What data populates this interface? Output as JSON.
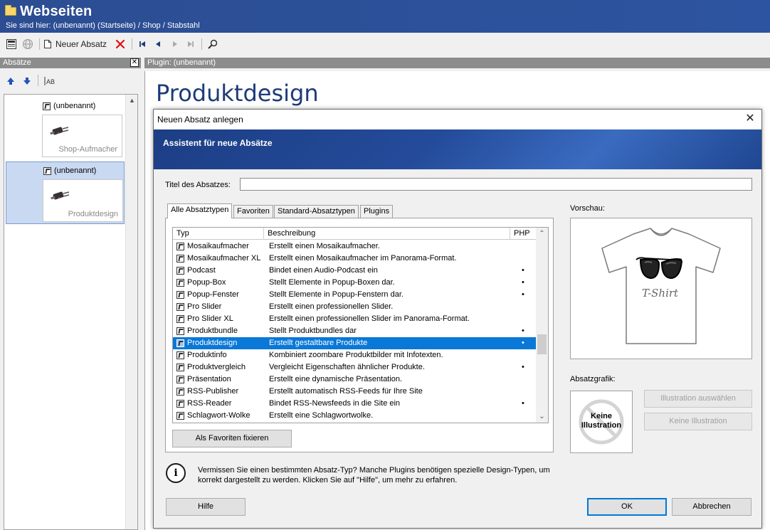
{
  "header": {
    "title": "Webseiten",
    "breadcrumb": "Sie sind hier: (unbenannt) (Startseite) / Shop / Stabstahl"
  },
  "toolbar": {
    "new_paragraph_label": "Neuer Absatz"
  },
  "left_panel": {
    "title": "Absätze",
    "items": [
      {
        "label": "(unbenannt)",
        "thumb_caption": "Shop-Aufmacher",
        "selected": false
      },
      {
        "label": "(unbenannt)",
        "thumb_caption": "Produktdesign",
        "selected": true
      }
    ]
  },
  "right_panel": {
    "title": "Plugin: (unbenannt)",
    "page_heading": "Produktdesign"
  },
  "dialog": {
    "title": "Neuen Absatz anlegen",
    "banner": "Assistent für neue Absätze",
    "title_field_label": "Titel des Absatzes:",
    "title_field_value": "",
    "tabs": [
      "Alle Absatztypen",
      "Favoriten",
      "Standard-Absatztypen",
      "Plugins"
    ],
    "active_tab": "Alle Absatztypen",
    "columns": [
      "Typ",
      "Beschreibung",
      "PHP"
    ],
    "rows": [
      {
        "typ": "Mosaikaufmacher",
        "desc": "Erstellt einen Mosaikaufmacher.",
        "php": ""
      },
      {
        "typ": "Mosaikaufmacher XL",
        "desc": "Erstellt einen Mosaikaufmacher im Panorama-Format.",
        "php": ""
      },
      {
        "typ": "Podcast",
        "desc": "Bindet einen Audio-Podcast ein",
        "php": "•"
      },
      {
        "typ": "Popup-Box",
        "desc": "Stellt Elemente in Popup-Boxen dar.",
        "php": "•"
      },
      {
        "typ": "Popup-Fenster",
        "desc": "Stellt Elemente in Popup-Fenstern dar.",
        "php": "•"
      },
      {
        "typ": "Pro Slider",
        "desc": "Erstellt einen professionellen Slider.",
        "php": ""
      },
      {
        "typ": "Pro Slider XL",
        "desc": "Erstellt einen professionellen Slider im Panorama-Format.",
        "php": ""
      },
      {
        "typ": "Produktbundle",
        "desc": "Stellt Produktbundles dar",
        "php": "•"
      },
      {
        "typ": "Produktdesign",
        "desc": "Erstellt gestaltbare Produkte",
        "php": "•",
        "selected": true
      },
      {
        "typ": "Produktinfo",
        "desc": "Kombiniert zoombare Produktbilder mit Infotexten.",
        "php": ""
      },
      {
        "typ": "Produktvergleich",
        "desc": "Vergleicht Eigenschaften ähnlicher Produkte.",
        "php": "•"
      },
      {
        "typ": "Präsentation",
        "desc": "Erstellt eine dynamische Präsentation.",
        "php": ""
      },
      {
        "typ": "RSS-Publisher",
        "desc": "Erstellt automatisch RSS-Feeds für Ihre Site",
        "php": ""
      },
      {
        "typ": "RSS-Reader",
        "desc": "Bindet RSS-Newsfeeds in die Site ein",
        "php": "•"
      },
      {
        "typ": "Schlagwort-Wolke",
        "desc": "Erstellt eine Schlagwortwolke.",
        "php": ""
      }
    ],
    "favorite_button": "Als Favoriten fixieren",
    "preview_label": "Vorschau:",
    "preview_text": "T-Shirt",
    "graphic_label": "Absatzgrafik:",
    "no_illustration_line1": "Keine",
    "no_illustration_line2": "Illustration",
    "select_illustration_button": "Illustration auswählen",
    "no_illustration_button": "Keine Illustration",
    "info_line1": "Vermissen Sie einen bestimmten Absatz-Typ? Manche Plugins benötigen spezielle Design-Typen, um",
    "info_line2": "korrekt dargestellt zu werden. Klicken Sie auf \"Hilfe\", um mehr zu erfahren.",
    "help_button": "Hilfe",
    "ok_button": "OK",
    "cancel_button": "Abbrechen"
  },
  "colors": {
    "header_blue": "#2c4d92",
    "heading_blue": "#1d3b78",
    "selection_blue": "#0a78d7",
    "panel_gray": "#8c8c8c"
  }
}
